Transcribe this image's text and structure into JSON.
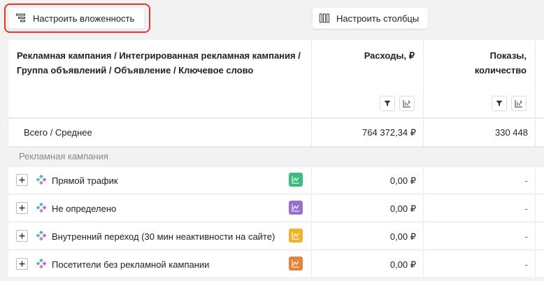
{
  "toolbar": {
    "nesting_label": "Настроить вложенность",
    "columns_label": "Настроить столбцы"
  },
  "table": {
    "header": {
      "name": "Рекламная кампания / Интегрированная рекламная кампания / Группа объявлений / Объявление / Ключевое слово",
      "cost_line1": "Расходы, ₽",
      "impressions_line1": "Показы,",
      "impressions_line2": "количество"
    },
    "total": {
      "label": "Всего / Среднее",
      "cost": "764 372,34 ₽",
      "impressions": "330 448"
    },
    "section_label": "Рекламная кампания",
    "rows": [
      {
        "label": "Прямой трафик",
        "cost": "0,00 ₽",
        "impressions": "-",
        "chip_color": "#3dbd7d"
      },
      {
        "label": "Не определено",
        "cost": "0,00 ₽",
        "impressions": "-",
        "chip_color": "#9b6fd0"
      },
      {
        "label": "Внутренний переход (30 мин неактивности на сайте)",
        "cost": "0,00 ₽",
        "impressions": "-",
        "chip_color": "#efb32f"
      },
      {
        "label": "Посетители без рекламной кампании",
        "cost": "0,00 ₽",
        "impressions": "-",
        "chip_color": "#e8823a"
      }
    ]
  }
}
